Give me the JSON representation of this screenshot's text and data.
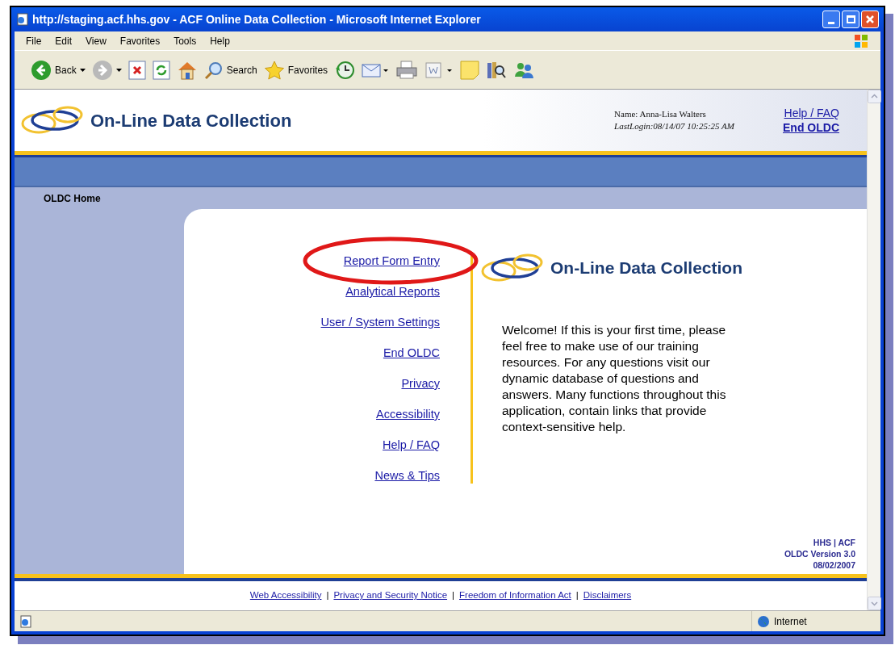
{
  "window": {
    "title": "http://staging.acf.hhs.gov - ACF Online Data Collection - Microsoft Internet Explorer"
  },
  "menu": [
    "File",
    "Edit",
    "View",
    "Favorites",
    "Tools",
    "Help"
  ],
  "toolbar": [
    {
      "kind": "back",
      "label": "Back"
    },
    {
      "kind": "forward"
    },
    {
      "kind": "stop"
    },
    {
      "kind": "refresh"
    },
    {
      "kind": "home"
    },
    {
      "kind": "search",
      "label": "Search"
    },
    {
      "kind": "favorites",
      "label": "Favorites"
    },
    {
      "kind": "history"
    },
    {
      "kind": "mail"
    },
    {
      "kind": "print"
    },
    {
      "kind": "edit"
    },
    {
      "kind": "note"
    },
    {
      "kind": "research"
    },
    {
      "kind": "messenger"
    }
  ],
  "header": {
    "title": "On-Line Data Collection",
    "user_name": "Name: Anna-Lisa Walters",
    "last_login": "LastLogin:08/14/07 10:25:25 AM",
    "links": [
      "Help / FAQ",
      "End OLDC"
    ]
  },
  "breadcrumb": "OLDC Home",
  "nav_links": [
    {
      "label": "Report Form Entry",
      "circled": true
    },
    {
      "label": "Analytical Reports",
      "circled": false
    },
    {
      "label": "User / System Settings",
      "circled": false
    },
    {
      "label": "End OLDC",
      "circled": false
    },
    {
      "label": "Privacy",
      "circled": false
    },
    {
      "label": "Accessibility",
      "circled": false
    },
    {
      "label": "Help / FAQ",
      "circled": false
    },
    {
      "label": "News & Tips",
      "circled": false
    }
  ],
  "welcome": {
    "title": "On-Line Data Collection",
    "text": "Welcome! If this is your first time, please feel free to make use of our training resources. For any questions visit our dynamic database of questions and answers. Many functions throughout this application, contain links that provide context-sensitive help."
  },
  "version": [
    "HHS | ACF",
    "OLDC Version 3.0",
    "08/02/2007"
  ],
  "footer_separator": "|",
  "footer_links": [
    "Web Accessibility",
    "Privacy and Security Notice",
    "Freedom of Information Act",
    "Disclaimers"
  ],
  "status_bar": {
    "zone": "Internet"
  }
}
